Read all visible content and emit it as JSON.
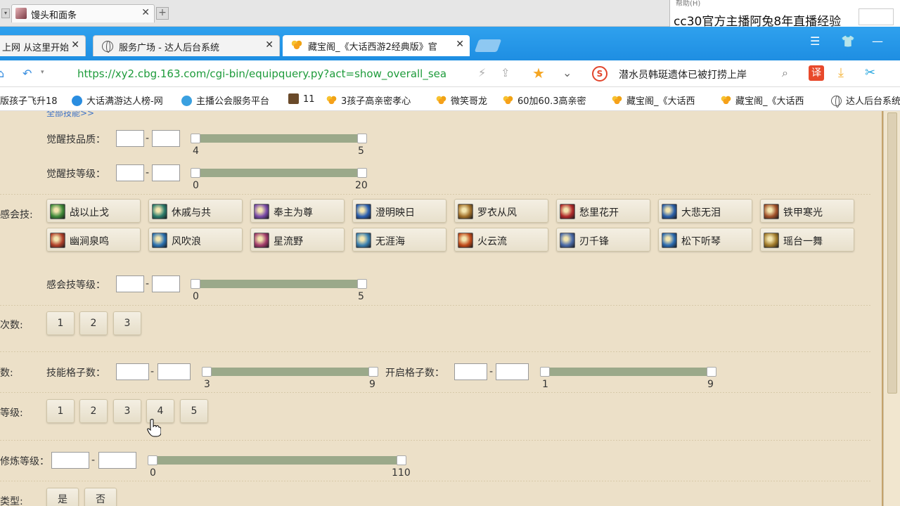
{
  "outer_window": {
    "tab_title": "馒头和面条",
    "danmaku_help": "帮助(H)",
    "danmaku_text": "cc30官方主播阿兔8年直播经验"
  },
  "browser": {
    "tabs": [
      {
        "label": "上网 从这里开始"
      },
      {
        "label": "服务广场 - 达人后台系统"
      },
      {
        "label": "藏宝阁_《大话西游2经典版》官"
      }
    ],
    "url": "https://xy2.cbg.163.com/cgi-bin/equipquery.py?act=show_overall_sea",
    "search_suggestion": "潜水员韩珽遗体已被打捞上岸",
    "bookmarks": [
      {
        "label": "版孩子飞升18"
      },
      {
        "label": "大话满游达人榜-网"
      },
      {
        "label": "主播公会服务平台"
      },
      {
        "label": "11"
      },
      {
        "label": "3孩子高亲密孝心"
      },
      {
        "label": "微笑哥龙"
      },
      {
        "label": "60加60.3高亲密"
      },
      {
        "label": "藏宝阁_《大话西"
      },
      {
        "label": "藏宝阁_《大话西"
      },
      {
        "label": "达人后台系统"
      }
    ]
  },
  "form": {
    "cut_link": "全部技能>>",
    "awaken_quality": {
      "label": "觉醒技品质：",
      "min": "4",
      "max": "5"
    },
    "awaken_level": {
      "label": "觉醒技等级：",
      "min": "0",
      "max": "20"
    },
    "insight_skill_label": "感会技:",
    "insight_skills": [
      {
        "label": "战以止戈",
        "color": "#3f8a3a"
      },
      {
        "label": "休戚与共",
        "color": "#2a7a6a"
      },
      {
        "label": "奉主为尊",
        "color": "#7a4aa8"
      },
      {
        "label": "澄明映日",
        "color": "#2a5fb0"
      },
      {
        "label": "罗衣从风",
        "color": "#a0702a"
      },
      {
        "label": "愁里花开",
        "color": "#b02a2a"
      },
      {
        "label": "大悲无泪",
        "color": "#2a5fa8"
      },
      {
        "label": "铁甲寒光",
        "color": "#a0502a"
      },
      {
        "label": "幽涧泉鸣",
        "color": "#b0402a"
      },
      {
        "label": "风吹浪",
        "color": "#2a70b0"
      },
      {
        "label": "星流野",
        "color": "#a03a6a"
      },
      {
        "label": "无涯海",
        "color": "#3a80b0"
      },
      {
        "label": "火云流",
        "color": "#c04a1a"
      },
      {
        "label": "刃千锋",
        "color": "#4a6aa8"
      },
      {
        "label": "松下听琴",
        "color": "#2a6ab0"
      },
      {
        "label": "瑶台一舞",
        "color": "#a07a2a"
      }
    ],
    "insight_level": {
      "label": "感会技等级：",
      "min": "0",
      "max": "5"
    },
    "count_label": "次数:",
    "count_options": [
      "1",
      "2",
      "3"
    ],
    "slots_row_label": "数:",
    "skill_slots": {
      "label": "技能格子数：",
      "min": "3",
      "max": "9"
    },
    "open_slots": {
      "label": "开启格子数：",
      "min": "1",
      "max": "9"
    },
    "grade_label": "等级:",
    "grade_options": [
      "1",
      "2",
      "3",
      "4",
      "5"
    ],
    "cultivation_level": {
      "label": "修炼等级：",
      "min": "0",
      "max": "110"
    },
    "type_label": "类型:",
    "type_options": [
      "是",
      "否"
    ]
  }
}
